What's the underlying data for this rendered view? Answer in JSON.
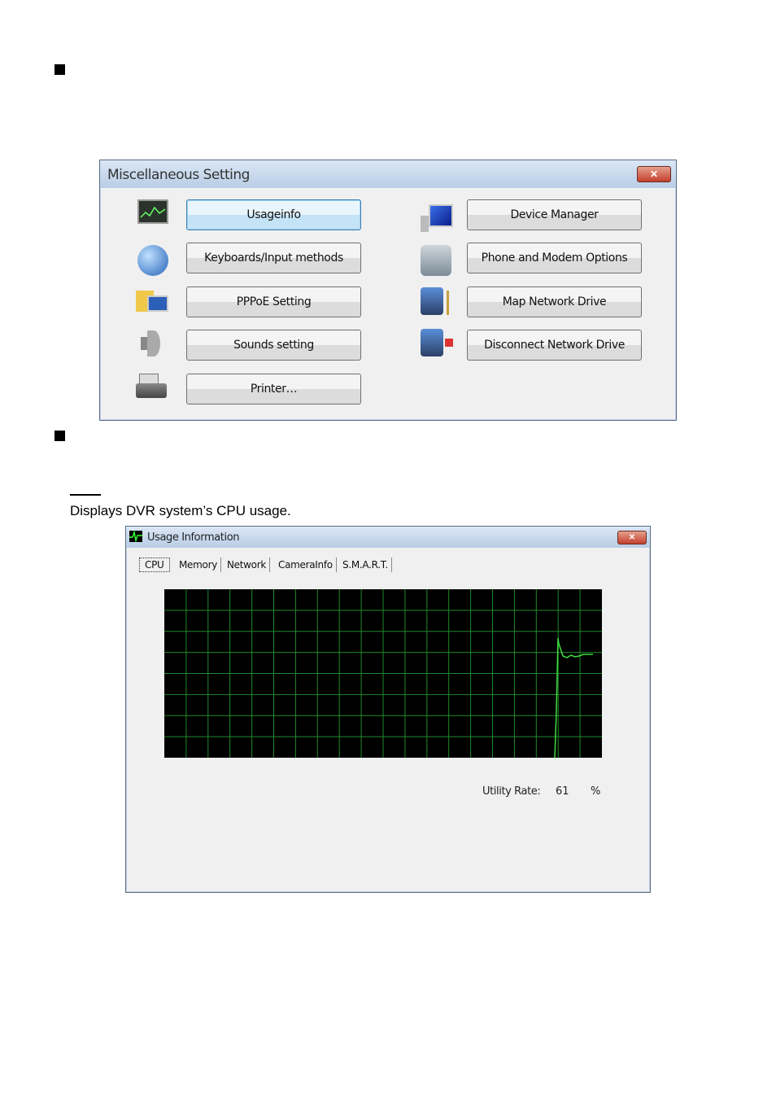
{
  "misc_window": {
    "title": "Miscellaneous Setting",
    "close_label": "✕",
    "left_buttons": [
      {
        "label": "Usageinfo",
        "icon": "usage-chart-icon"
      },
      {
        "label": "Keyboards/Input methods",
        "icon": "globe-icon"
      },
      {
        "label": "PPPoE Setting",
        "icon": "network-folder-icon"
      },
      {
        "label": "Sounds setting",
        "icon": "speaker-icon"
      },
      {
        "label": "Printer…",
        "icon": "printer-icon"
      }
    ],
    "right_buttons": [
      {
        "label": "Device Manager",
        "icon": "computer-icon"
      },
      {
        "label": "Phone and Modem Options",
        "icon": "phone-modem-icon"
      },
      {
        "label": "Map Network Drive",
        "icon": "map-drive-icon"
      },
      {
        "label": "Disconnect Network Drive",
        "icon": "disconnect-drive-icon"
      }
    ]
  },
  "doc": {
    "caption": "Displays DVR system’s CPU usage."
  },
  "usage_window": {
    "title": "Usage Information",
    "close_label": "✕",
    "tabs": [
      "CPU",
      "Memory",
      "Network",
      "CameraInfo",
      "S.M.A.R.T."
    ],
    "active_tab": "CPU",
    "utility_label": "Utility Rate:",
    "utility_value": "61",
    "utility_unit": "%",
    "graph_colors": {
      "background": "#000000",
      "grid": "#1f8a2a",
      "line": "#3fdc3f"
    }
  }
}
